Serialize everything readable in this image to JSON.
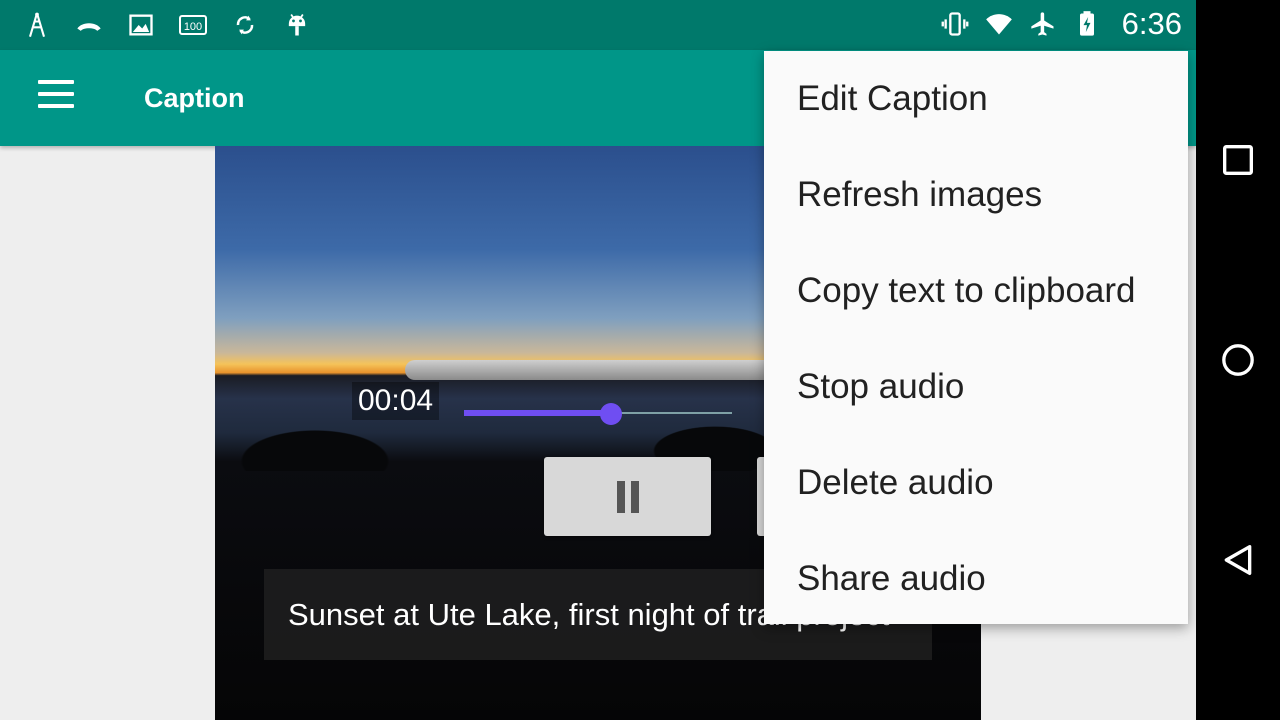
{
  "status_bar": {
    "time": "6:36",
    "left_icons": [
      "antenna-icon",
      "missed-call-icon",
      "image-icon",
      "battery-100-icon",
      "sync-icon",
      "android-icon"
    ],
    "right_icons": [
      "vibrate-icon",
      "wifi-icon",
      "airplane-icon",
      "battery-icon"
    ],
    "badge_100": "100"
  },
  "app_bar": {
    "title": "Caption",
    "color": "#009688"
  },
  "player": {
    "time": "00:04",
    "progress": 0.55,
    "accent": "#6f4ef2"
  },
  "caption": {
    "text": "Sunset at Ute Lake, first night of trail project"
  },
  "menu": {
    "items": [
      {
        "label": "Edit Caption"
      },
      {
        "label": "Refresh images"
      },
      {
        "label": "Copy text to clipboard"
      },
      {
        "label": "Stop audio"
      },
      {
        "label": "Delete audio"
      },
      {
        "label": "Share audio"
      }
    ]
  }
}
